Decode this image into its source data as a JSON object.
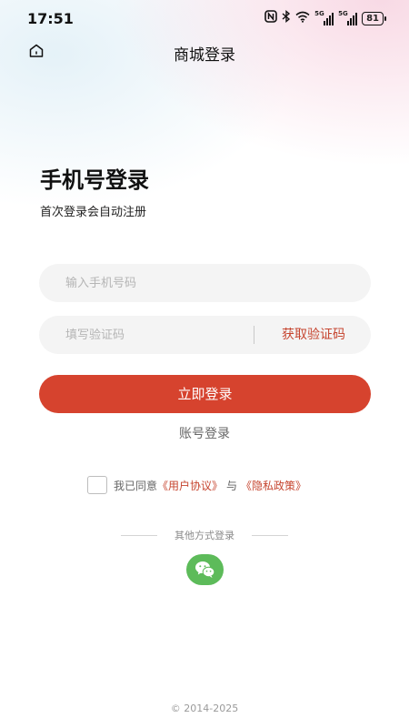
{
  "status_bar": {
    "time": "17:51",
    "icons": [
      "nfc-icon",
      "bluetooth-icon",
      "wifi-icon",
      "signal-5g-icon",
      "signal-5g-icon"
    ],
    "signal_label": "5G",
    "battery": "81"
  },
  "nav": {
    "title": "商城登录",
    "home_icon": "home-icon"
  },
  "login": {
    "heading": "手机号登录",
    "subheading": "首次登录会自动注册",
    "phone_placeholder": "输入手机号码",
    "code_placeholder": "填写验证码",
    "get_code_label": "获取验证码",
    "submit_label": "立即登录",
    "account_login_label": "账号登录"
  },
  "agreement": {
    "prefix": "我已同意",
    "user_agreement": "《用户协议》",
    "connector": "与",
    "privacy_policy": "《隐私政策》",
    "checked": false
  },
  "other_login": {
    "label": "其他方式登录",
    "options": [
      "wechat-icon"
    ]
  },
  "footer": {
    "copyright": "© 2014-2025"
  },
  "colors": {
    "accent": "#d6432e",
    "link": "#c6452f",
    "wechat": "#5dbb5a",
    "field_bg": "#f4f4f4"
  }
}
